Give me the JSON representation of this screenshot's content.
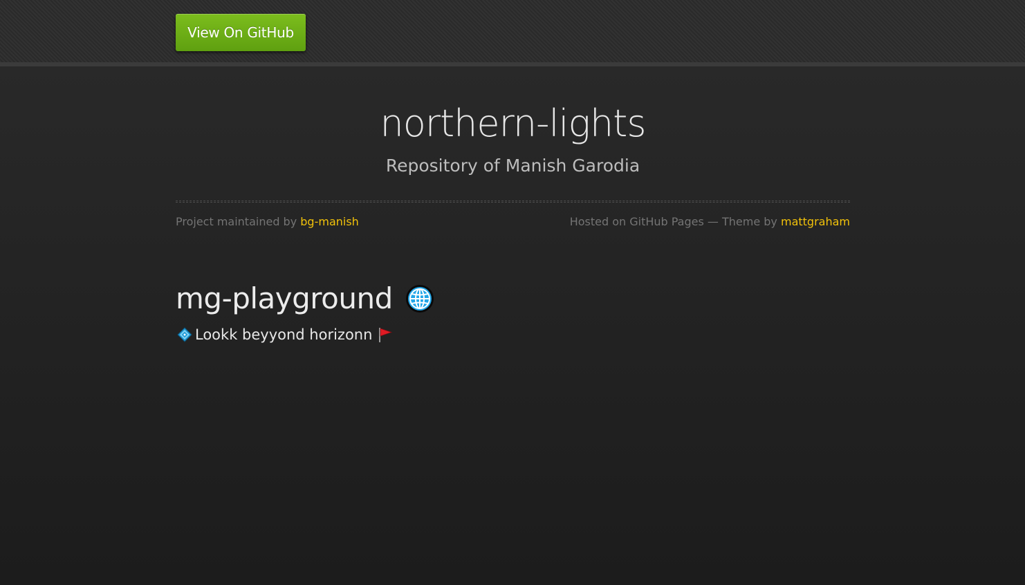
{
  "header": {
    "github_button_label": "View On GitHub"
  },
  "hero": {
    "title": "northern-lights",
    "subtitle": "Repository of Manish Garodia"
  },
  "credits": {
    "maintained_prefix": "Project maintained by ",
    "maintainer_link": "bg-manish",
    "hosted_text": "Hosted on GitHub Pages — Theme by ",
    "theme_author_link": "mattgraham"
  },
  "content": {
    "heading": "mg-playground",
    "heading_icon": "globe-icon",
    "tagline": "Lookk beyyond horizonn",
    "tagline_leading_icon": "diamond-icon",
    "tagline_trailing_icon": "flag-icon"
  },
  "colors": {
    "background": "#212121",
    "button_green": "#6aad14",
    "link_yellow": "#f2c20a",
    "muted_text": "#747474"
  }
}
